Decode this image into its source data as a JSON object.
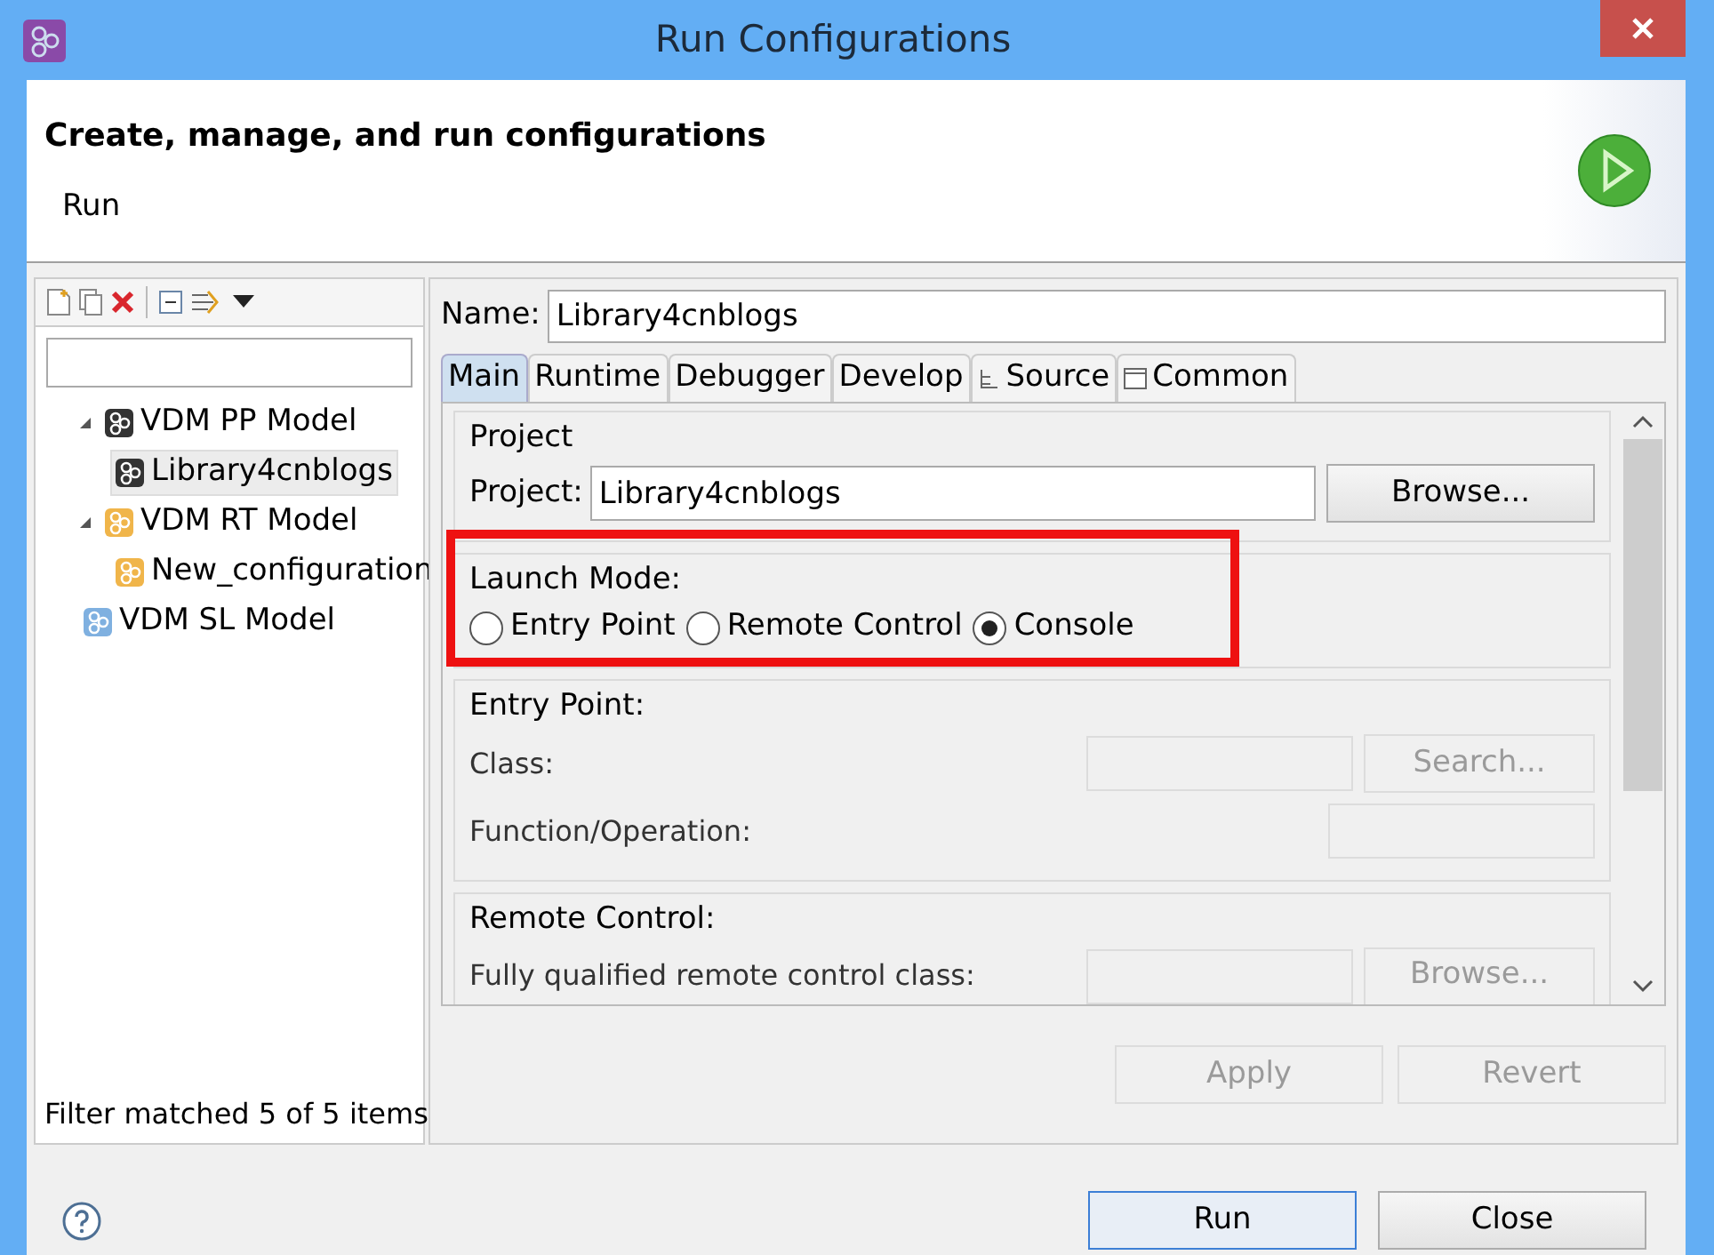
{
  "window": {
    "title": "Run Configurations"
  },
  "header": {
    "title": "Create, manage, and run configurations",
    "subtitle": "Run"
  },
  "sidebar": {
    "tree": [
      {
        "label": "VDM PP Model",
        "kind": "pp",
        "expanded": true,
        "selected": false,
        "children": [
          {
            "label": "Library4cnblogs",
            "kind": "pp",
            "selected": true
          }
        ]
      },
      {
        "label": "VDM RT Model",
        "kind": "rt",
        "expanded": true,
        "selected": false,
        "children": [
          {
            "label": "New_configuration",
            "kind": "rt",
            "selected": false
          }
        ]
      },
      {
        "label": "VDM SL Model",
        "kind": "sl",
        "selected": false
      }
    ],
    "status": "Filter matched 5 of 5 items"
  },
  "name_field": {
    "label": "Name:",
    "value": "Library4cnblogs"
  },
  "tabs": [
    {
      "label": "Main",
      "selected": true
    },
    {
      "label": "Runtime",
      "selected": false
    },
    {
      "label": "Debugger",
      "selected": false
    },
    {
      "label": "Develop",
      "selected": false
    },
    {
      "label": "Source",
      "selected": false,
      "kind": "source"
    },
    {
      "label": "Common",
      "selected": false,
      "kind": "common"
    }
  ],
  "project": {
    "group": "Project",
    "label": "Project:",
    "value": "Library4cnblogs",
    "button": "Browse..."
  },
  "launch_mode": {
    "group": "Launch Mode:",
    "options": [
      {
        "label": "Entry Point",
        "selected": false
      },
      {
        "label": "Remote Control",
        "selected": false
      },
      {
        "label": "Console",
        "selected": true
      }
    ]
  },
  "entry_point": {
    "group": "Entry Point:",
    "fields": [
      {
        "label": "Class:",
        "disabled": true,
        "button": "Search..."
      },
      {
        "label": "Function/Operation:",
        "disabled": true
      }
    ]
  },
  "remote_control": {
    "group": "Remote Control:",
    "fields": [
      {
        "label": "Fully qualified remote control class:",
        "disabled": true,
        "button": "Browse..."
      }
    ]
  },
  "actions": [
    {
      "label": "Apply",
      "disabled": true
    },
    {
      "label": "Revert",
      "disabled": true
    }
  ],
  "footer": [
    {
      "label": "Run",
      "default": true
    },
    {
      "label": "Close",
      "default": false
    }
  ]
}
